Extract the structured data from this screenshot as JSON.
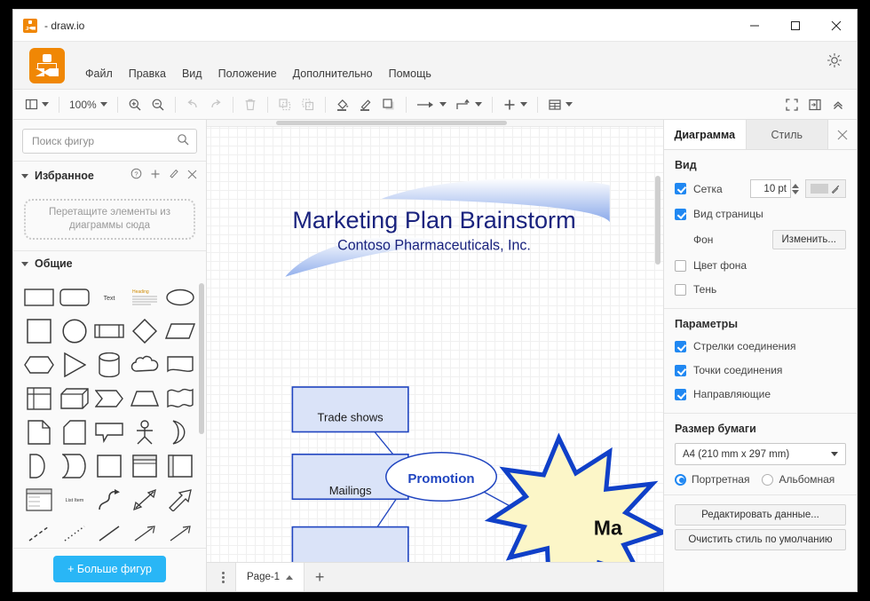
{
  "window": {
    "title": "- draw.io",
    "app_icon": "drawio-logo-icon",
    "minimize": "minimize-icon",
    "maximize": "maximize-icon",
    "close": "close-icon"
  },
  "menubar": {
    "items": [
      {
        "label": "Файл"
      },
      {
        "label": "Правка"
      },
      {
        "label": "Вид"
      },
      {
        "label": "Положение"
      },
      {
        "label": "Дополнительно"
      },
      {
        "label": "Помощь"
      }
    ],
    "theme_toggle": "sun-icon"
  },
  "toolbar": {
    "zoom_value": "100%",
    "icons": [
      "panel-layout-icon",
      "zoom-in-icon",
      "zoom-out-icon",
      "undo-icon",
      "redo-icon",
      "delete-icon",
      "to-front-icon",
      "to-back-icon",
      "fill-color-icon",
      "line-color-icon",
      "shadow-icon",
      "connection-arrow-icon",
      "waypoints-icon",
      "insert-icon",
      "table-icon",
      "fullscreen-icon",
      "format-panel-icon",
      "collapse-icon"
    ]
  },
  "left_panel": {
    "search": {
      "placeholder": "Поиск фигур",
      "value": "",
      "icon": "search-icon"
    },
    "favorites": {
      "title": "Избранное",
      "icons": [
        "help-icon",
        "plus-icon",
        "edit-icon",
        "close-icon"
      ],
      "dropzone_line1": "Перетащите элементы из",
      "dropzone_line2": "диаграммы сюда"
    },
    "general": {
      "title": "Общие",
      "shapes": [
        "rectangle",
        "rounded-rectangle",
        "text",
        "textbox",
        "ellipse",
        "square",
        "circle",
        "process",
        "diamond",
        "parallelogram",
        "hexagon",
        "triangle",
        "cylinder",
        "cloud",
        "document",
        "internal-storage",
        "cube",
        "step",
        "trapezoid",
        "tape",
        "note",
        "card",
        "callout",
        "actor",
        "or",
        "and",
        "data-storage",
        "container",
        "vertical-container",
        "horizontal-container",
        "list",
        "list-item",
        "curve",
        "bidirectional-arrow",
        "arrow",
        "dashed-line",
        "dotted-line",
        "line",
        "directional-connector",
        "connector"
      ]
    },
    "more_shapes_button": "+ Больше фигур"
  },
  "canvas": {
    "diagram": {
      "title": "Marketing Plan Brainstorm",
      "subtitle": "Contoso Pharmaceuticals, Inc.",
      "nodes": [
        {
          "id": "trade-shows",
          "label": "Trade shows",
          "shape": "rectangle"
        },
        {
          "id": "mailings",
          "label": "Mailings",
          "shape": "rectangle"
        },
        {
          "id": "promotion",
          "label": "Promotion",
          "shape": "ellipse"
        },
        {
          "id": "marketing-star",
          "label": "Ma",
          "shape": "star"
        }
      ],
      "colors": {
        "node_fill": "#dae3f8",
        "node_border": "#2045c0",
        "title_text": "#1a237e",
        "star_fill": "#fcf6c8",
        "star_border": "#1040c8",
        "swoosh": "#a8c0f0"
      }
    }
  },
  "pages": {
    "menu_icon": "kebab-menu-icon",
    "current_tab": "Page-1",
    "tab_chevron": "chevron-up-icon",
    "add_page": "+"
  },
  "right_panel": {
    "tabs": [
      {
        "label": "Диаграмма",
        "active": true
      },
      {
        "label": "Стиль",
        "active": false
      }
    ],
    "close_icon": "close-icon",
    "view": {
      "heading": "Вид",
      "grid": {
        "label": "Сетка",
        "checked": true,
        "size": "10 pt",
        "color_swatch": "#cfcfcf",
        "picker_icon": "eyedropper-icon"
      },
      "page_view": {
        "label": "Вид страницы",
        "checked": true
      },
      "background": {
        "label": "Фон",
        "button": "Изменить..."
      },
      "background_color": {
        "label": "Цвет фона",
        "checked": false
      },
      "shadow": {
        "label": "Тень",
        "checked": false
      }
    },
    "options": {
      "heading": "Параметры",
      "items": [
        {
          "label": "Стрелки соединения",
          "checked": true
        },
        {
          "label": "Точки соединения",
          "checked": true
        },
        {
          "label": "Направляющие",
          "checked": true
        }
      ]
    },
    "paper": {
      "heading": "Размер бумаги",
      "selected": "A4 (210 mm x 297 mm)",
      "orientation": [
        {
          "label": "Портретная",
          "selected": true
        },
        {
          "label": "Альбомная",
          "selected": false
        }
      ]
    },
    "actions": [
      {
        "label": "Редактировать данные..."
      },
      {
        "label": "Очистить стиль по умолчанию"
      }
    ]
  }
}
